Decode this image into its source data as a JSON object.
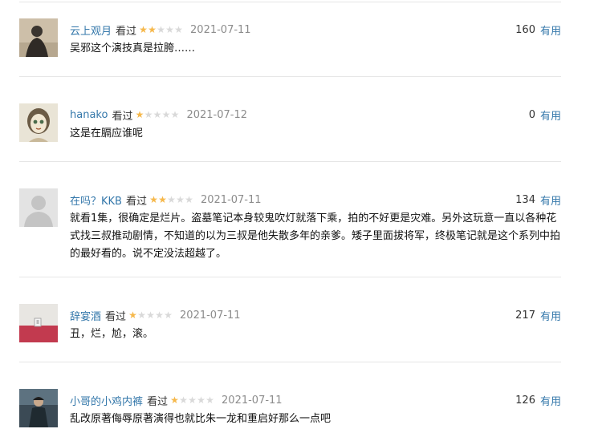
{
  "reviews": [
    {
      "user": "云上观月",
      "watched": "看过",
      "rating": 2,
      "date": "2021-07-11",
      "votes": "160",
      "useful_label": "有用",
      "text": "吴邪这个演技真是拉胯……"
    },
    {
      "user": "hanako",
      "watched": "看过",
      "rating": 1,
      "date": "2021-07-12",
      "votes": "0",
      "useful_label": "有用",
      "text": "这是在膈应谁呢"
    },
    {
      "user": "在吗？KKB",
      "watched": "看过",
      "rating": 2,
      "date": "2021-07-11",
      "votes": "134",
      "useful_label": "有用",
      "text": "就看1集，很确定是烂片。盗墓笔记本身较鬼吹灯就落下乘，拍的不好更是灾难。另外这玩意一直以各种花式找三叔推动剧情，不知道的以为三叔是他失散多年的亲爹。矮子里面拔将军，终极笔记就是这个系列中拍的最好看的。说不定没法超越了。"
    },
    {
      "user": "辞宴酒",
      "watched": "看过",
      "rating": 1,
      "date": "2021-07-11",
      "votes": "217",
      "useful_label": "有用",
      "text": "丑，烂，尬，滚。"
    },
    {
      "user": "小哥的小鸡内裤",
      "watched": "看过",
      "rating": 1,
      "date": "2021-07-11",
      "votes": "126",
      "useful_label": "有用",
      "text": "乱改原著侮辱原著演得也就比朱一龙和重启好那么一点吧"
    }
  ],
  "colors": {
    "link": "#3377aa",
    "star_on": "#f6b84b",
    "star_off": "#d9d9d9",
    "date": "#8c8c8c",
    "divider": "#e6e6e6"
  }
}
